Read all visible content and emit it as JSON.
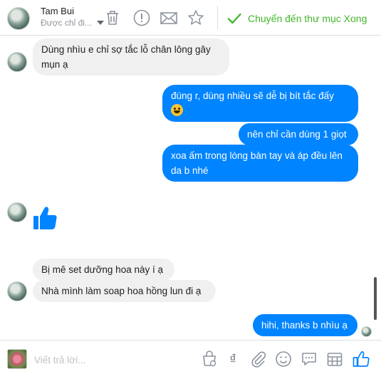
{
  "header": {
    "contact_name": "Tam Bui",
    "assigned_label": "Được chỉ đi...",
    "move_done_label": "Chuyển đến thư mục Xong"
  },
  "messages": [
    {
      "from": "contact",
      "text": "Dùng nhìu e chỉ sợ tắc lỗ chân lông gây mụn ạ",
      "lines": [
        "Dùng nhìu e chỉ sợ tắc lỗ chân lông gây",
        "mụn ạ"
      ]
    },
    {
      "from": "page",
      "lines": [
        "đúng r, dùng nhiều sẽ dễ bị bít tắc đấy"
      ],
      "emoji": "smiley"
    },
    {
      "from": "page",
      "lines": [
        "nên chỉ cần dùng 1 giọt"
      ]
    },
    {
      "from": "page",
      "lines": [
        "xoa ấm trong lòng bàn tay và áp đều lên",
        "da b nhé"
      ]
    },
    {
      "from": "contact",
      "sticker": "like-thumb"
    },
    {
      "from": "contact",
      "lines": [
        "Bị mê set dưỡng hoa này í ạ"
      ]
    },
    {
      "from": "contact",
      "lines": [
        "Nhà mình làm soap hoa hồng lun đi ạ"
      ]
    },
    {
      "from": "page",
      "lines": [
        "hihi, thanks b nhìu ạ"
      ]
    }
  ],
  "composer": {
    "placeholder": "Viết trả lời...",
    "currency_symbol": "₫"
  },
  "colors": {
    "accent": "#0084ff",
    "done_green": "#42b72a",
    "incoming_bubble": "#f1f0f0",
    "icon_gray": "#8d949e"
  }
}
